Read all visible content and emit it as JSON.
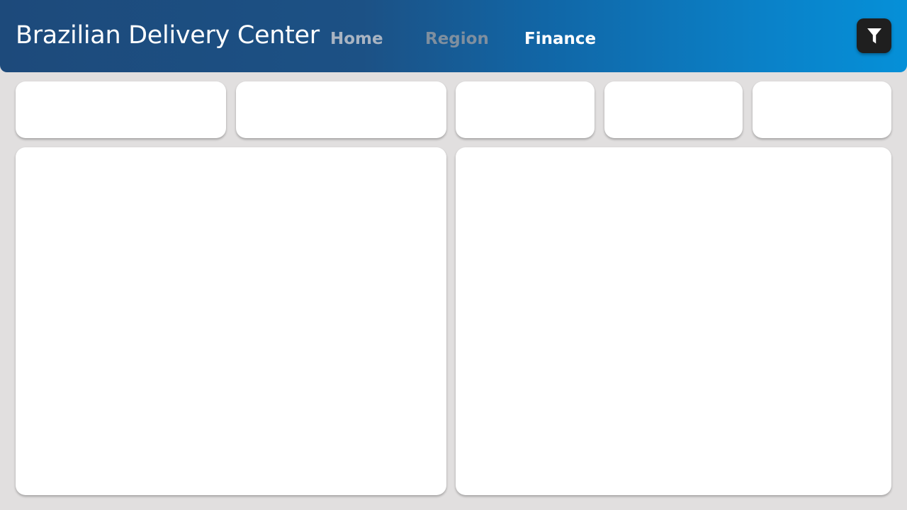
{
  "header": {
    "title": "Brazilian Delivery Center",
    "tabs": [
      {
        "label": "Home",
        "active": false
      },
      {
        "label": "Region",
        "active": false
      },
      {
        "label": "Finance",
        "active": true
      }
    ],
    "filter_icon": "filter-icon"
  },
  "colors": {
    "header_gradient_start": "#1d4a7b",
    "header_gradient_end": "#0590d8",
    "page_background": "#e1dfdf",
    "card_background": "#ffffff",
    "filter_button": "#1f1f1f"
  },
  "kpi_cards": [
    {
      "label": "",
      "value": ""
    },
    {
      "label": "",
      "value": ""
    },
    {
      "label": "",
      "value": ""
    },
    {
      "label": "",
      "value": ""
    },
    {
      "label": "",
      "value": ""
    }
  ],
  "panels": [
    {
      "title": ""
    },
    {
      "title": ""
    }
  ]
}
